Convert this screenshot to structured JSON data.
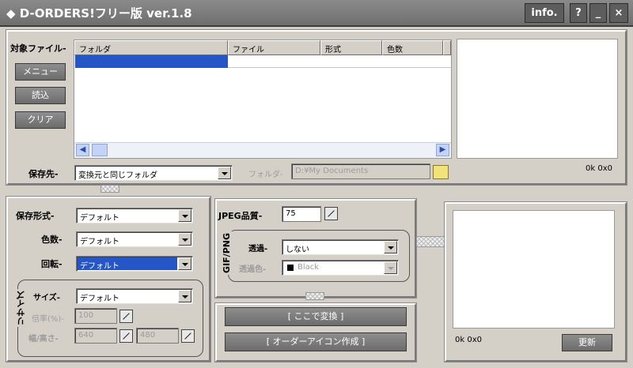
{
  "window": {
    "title": "◆ D-ORDERS!フリー版 ver.1.8",
    "info_btn": "info.",
    "help_btn": "?",
    "min_btn": "_",
    "close_btn": "×"
  },
  "files": {
    "label": "対象ファイル-",
    "menu_btn": "メニュー",
    "load_btn": "読込",
    "clear_btn": "クリア",
    "columns": [
      "フォルダ",
      "ファイル",
      "形式",
      "色数"
    ],
    "preview_info": "0k 0x0"
  },
  "save": {
    "dest_label": "保存先-",
    "dest_value": "変換元と同じフォルダ",
    "folder_label": "フォルダ-",
    "folder_value": "D:¥My Documents"
  },
  "format": {
    "format_label": "保存形式-",
    "format_value": "デフォルト",
    "colors_label": "色数-",
    "colors_value": "デフォルト",
    "rotate_label": "回転-",
    "rotate_value": "デフォルト",
    "resize_label": "リサイズ",
    "size_label": "サイズ-",
    "size_value": "デフォルト",
    "ratio_label": "倍率(%)-",
    "ratio_value": "100",
    "wh_label": "幅/高さ-",
    "width_value": "640",
    "height_value": "480"
  },
  "jpeg": {
    "quality_label": "JPEG品質-",
    "quality_value": "75"
  },
  "gifpng": {
    "group_label": "GIF/PNG",
    "transparent_label": "透過-",
    "transparent_value": "しない",
    "transcolor_label": "透過色-",
    "transcolor_value": "Black"
  },
  "actions": {
    "convert_btn": "[ ここで変換 ]",
    "icon_btn": "[ オーダーアイコン作成 ]"
  },
  "output": {
    "info": "0k 0x0",
    "update_btn": "更新"
  }
}
